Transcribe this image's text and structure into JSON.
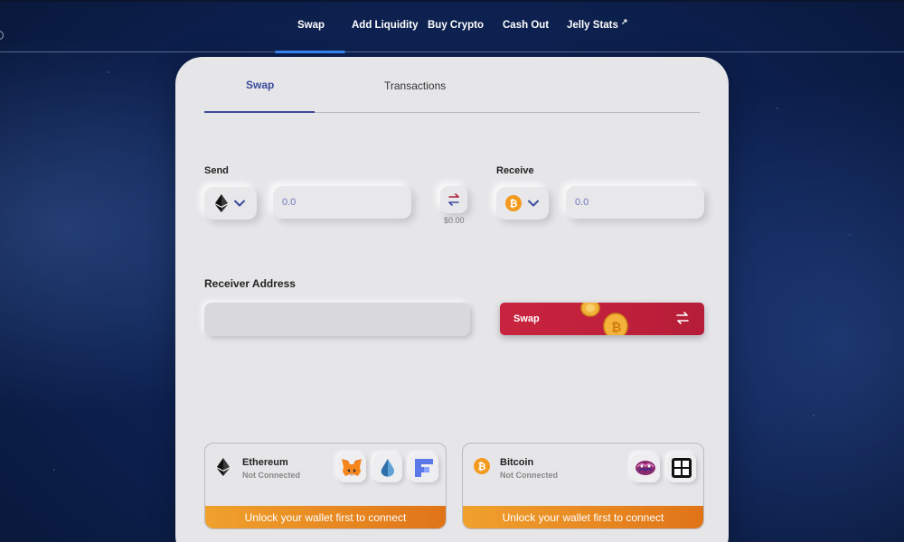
{
  "nav": {
    "items": [
      {
        "label": "Swap",
        "active": true
      },
      {
        "label": "Add Liquidity"
      },
      {
        "label": "Buy Crypto"
      },
      {
        "label": "Cash Out"
      },
      {
        "label": "Jelly Stats",
        "external": true
      }
    ]
  },
  "tabs": [
    {
      "label": "Swap",
      "active": true
    },
    {
      "label": "Transactions"
    }
  ],
  "send": {
    "label": "Send",
    "token_icon": "ethereum-icon",
    "amount_placeholder": "0.0",
    "usd_value": "$0.00"
  },
  "receive": {
    "label": "Receive",
    "token_icon": "bitcoin-icon",
    "amount_placeholder": "0.0"
  },
  "receiver": {
    "label": "Receiver Address",
    "placeholder": ""
  },
  "swap_button": {
    "label": "Swap"
  },
  "wallets": [
    {
      "chain": "Ethereum",
      "status": "Not Connected",
      "chain_icon": "ethereum-icon",
      "providers": [
        "metamask-icon",
        "lido-drop-icon",
        "frontier-icon"
      ],
      "unlock_label": "Unlock your wallet first to connect"
    },
    {
      "chain": "Bitcoin",
      "status": "Not Connected",
      "chain_icon": "bitcoin-icon",
      "providers": [
        "brain-wallet-icon",
        "ledger-grid-icon"
      ],
      "unlock_label": "Unlock your wallet first to connect"
    }
  ],
  "colors": {
    "accent_blue": "#3c4a9c",
    "nav_active": "#3d8bff",
    "swap_red": "#c9243f",
    "unlock_orange": "#e8891f",
    "bitcoin_orange": "#f39a1e"
  }
}
